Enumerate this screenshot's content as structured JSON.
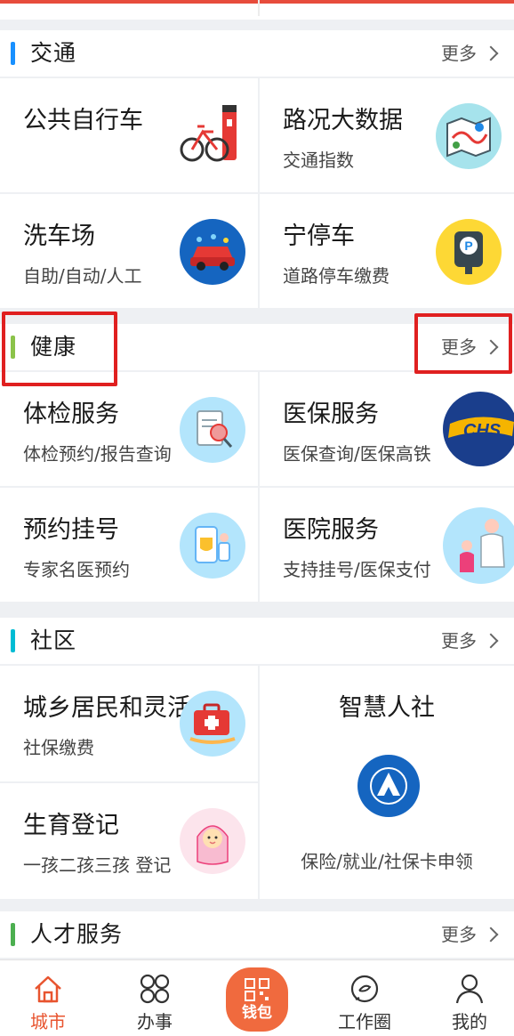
{
  "colors": {
    "accent_traffic": "#1890ff",
    "accent_health": "#8bc34a",
    "accent_community": "#00bcd4",
    "accent_talent": "#4caf50",
    "brand": "#f06a3e",
    "highlight_box": "#e02020"
  },
  "sections": {
    "traffic": {
      "title": "交通",
      "more": "更多",
      "items": [
        {
          "name": "公共自行车",
          "sub": "",
          "icon": "bicycle-icon"
        },
        {
          "name": "路况大数据",
          "sub": "交通指数",
          "icon": "map-icon"
        },
        {
          "name": "洗车场",
          "sub": "自助/自动/人工",
          "icon": "car-wash-icon"
        },
        {
          "name": "宁停车",
          "sub": "道路停车缴费",
          "icon": "parking-meter-icon"
        }
      ]
    },
    "health": {
      "title": "健康",
      "more": "更多",
      "items": [
        {
          "name": "体检服务",
          "sub": "体检预约/报告查询",
          "icon": "checkup-report-icon"
        },
        {
          "name": "医保服务",
          "sub": "医保查询/医保高铁",
          "icon": "chs-logo-icon"
        },
        {
          "name": "预约挂号",
          "sub": "专家名医预约",
          "icon": "appointment-icon"
        },
        {
          "name": "医院服务",
          "sub": "支持挂号/医保支付",
          "icon": "doctor-icon"
        }
      ]
    },
    "community": {
      "title": "社区",
      "more": "更多",
      "items": [
        {
          "name": "城乡居民和灵活",
          "sub": "社保缴费",
          "icon": "medical-kit-icon"
        },
        {
          "name": "智慧人社",
          "sub": "保险/就业/社保卡申领",
          "icon": "renshe-logo-icon"
        },
        {
          "name": "生育登记",
          "sub": "一孩二孩三孩 登记",
          "icon": "baby-icon"
        }
      ]
    },
    "talent": {
      "title": "人才服务",
      "more": "更多"
    }
  },
  "tabbar": {
    "items": [
      {
        "label": "城市",
        "icon": "home-icon",
        "active": true
      },
      {
        "label": "办事",
        "icon": "services-grid-icon",
        "active": false
      },
      {
        "label": "钱包",
        "icon": "wallet-qr-icon",
        "active": false
      },
      {
        "label": "工作圈",
        "icon": "chat-circle-icon",
        "active": false
      },
      {
        "label": "我的",
        "icon": "profile-icon",
        "active": false
      }
    ]
  }
}
